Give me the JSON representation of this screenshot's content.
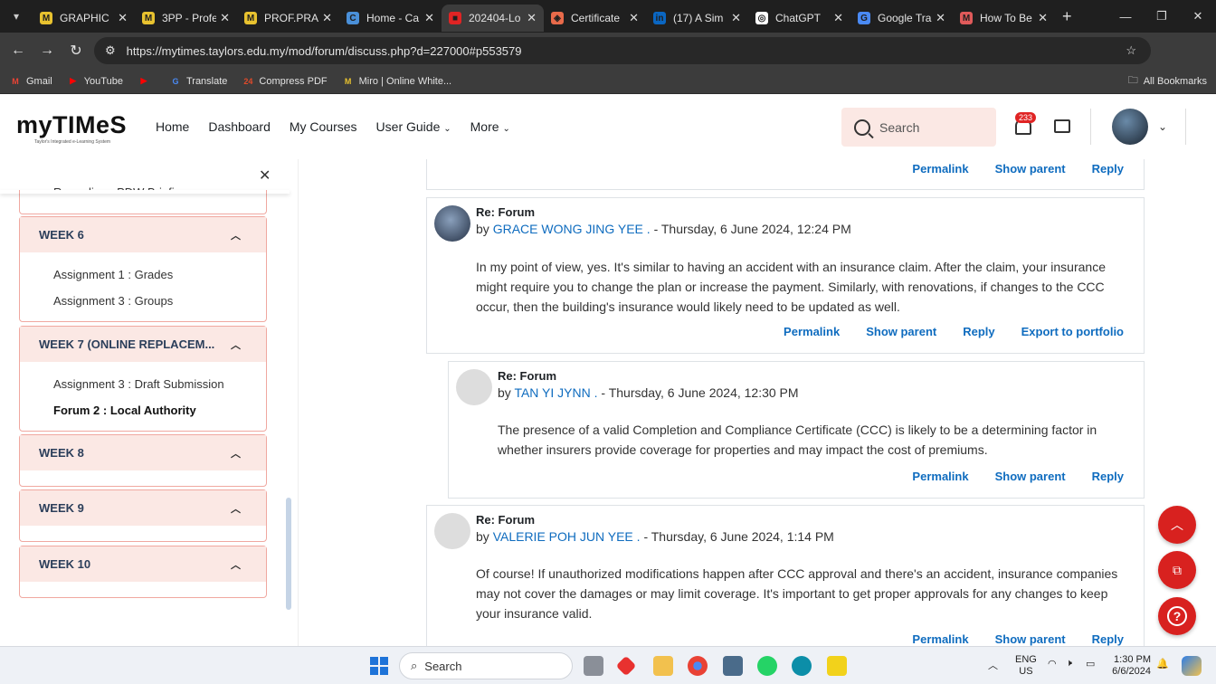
{
  "browser": {
    "tabs": [
      {
        "label": "GRAPHIC",
        "favicon": "M",
        "color": "#e8c22f"
      },
      {
        "label": "3PP - Profe",
        "favicon": "M",
        "color": "#e8c22f"
      },
      {
        "label": "PROF.PRAC",
        "favicon": "M",
        "color": "#e8c22f"
      },
      {
        "label": "Home - Ca",
        "favicon": "C",
        "color": "#4a90d9"
      },
      {
        "label": "202404-Lo",
        "favicon": "■",
        "color": "#e02424"
      },
      {
        "label": "Certificate",
        "favicon": "◈",
        "color": "#e86a4a"
      },
      {
        "label": "(17) A Sim",
        "favicon": "in",
        "color": "#0a66c2"
      },
      {
        "label": "ChatGPT",
        "favicon": "◎",
        "color": "#ffffff"
      },
      {
        "label": "Google Tra",
        "favicon": "G",
        "color": "#4a8af4"
      },
      {
        "label": "How To Be",
        "favicon": "M",
        "color": "#e05a5a"
      }
    ],
    "url": "https://mytimes.taylors.edu.my/mod/forum/discuss.php?d=227000#p553579",
    "profile_initial": "G",
    "bookmarks": [
      {
        "label": "Gmail",
        "icon": "M",
        "color": "#ea4335"
      },
      {
        "label": "YouTube",
        "icon": "▶",
        "color": "#ff0000"
      },
      {
        "label": "",
        "icon": "▶",
        "color": "#ff0000"
      },
      {
        "label": "Translate",
        "icon": "G",
        "color": "#4a8af4"
      },
      {
        "label": "Compress PDF",
        "icon": "24",
        "color": "#e04a2a"
      },
      {
        "label": "Miro | Online White...",
        "icon": "M",
        "color": "#e8c22f"
      }
    ],
    "all_bookmarks": "All Bookmarks"
  },
  "site": {
    "logo": "myTIMeS",
    "logo_sub": "Taylor's Integrated e-Learning System",
    "nav": [
      "Home",
      "Dashboard",
      "My Courses",
      "User Guide",
      "More"
    ],
    "search_placeholder": "Search",
    "notification_count": "233"
  },
  "sidebar": {
    "partial_item": "Recording : PDW Briefing",
    "weeks": [
      {
        "title": "WEEK 6",
        "items": [
          "Assignment 1 : Grades",
          "Assignment 3 : Groups"
        ]
      },
      {
        "title": "WEEK 7 (ONLINE REPLACEM...",
        "items": [
          "Assignment 3 : Draft Submission",
          "Forum 2 : Local Authority"
        ]
      },
      {
        "title": "WEEK 8",
        "items": []
      },
      {
        "title": "WEEK 9",
        "items": []
      },
      {
        "title": "WEEK 10",
        "items": []
      }
    ]
  },
  "posts": [
    {
      "subject": "Re: Forum",
      "by": "by",
      "author": "GRACE WONG JING YEE .",
      "date": "- Thursday, 6 June 2024, 12:24 PM",
      "body": "In my point of view, yes. It's similar to having an accident with an insurance claim. After the claim, your insurance might require you to change the plan or increase the payment. Similarly, with renovations, if changes to the CCC occur, then the building's insurance would likely need to be updated as well.",
      "actions": [
        "Permalink",
        "Show parent",
        "Reply",
        "Export to portfolio"
      ]
    },
    {
      "subject": "Re: Forum",
      "by": "by",
      "author": "TAN YI JYNN .",
      "date": "- Thursday, 6 June 2024, 12:30 PM",
      "body": "The presence of a valid Completion and Compliance Certificate (CCC) is likely to be a determining factor in whether insurers provide coverage for properties and may impact the cost of premiums.",
      "actions": [
        "Permalink",
        "Show parent",
        "Reply"
      ]
    },
    {
      "subject": "Re: Forum",
      "by": "by",
      "author": "VALERIE POH JUN YEE .",
      "date": "- Thursday, 6 June 2024, 1:14 PM",
      "body": "Of course! If unauthorized modifications happen after CCC approval and there's an accident, insurance companies may not cover the damages or may limit coverage. It's important to get proper approvals for any changes to keep your insurance valid.",
      "actions": [
        "Permalink",
        "Show parent",
        "Reply"
      ]
    }
  ],
  "top_actions": [
    "Permalink",
    "Show parent",
    "Reply"
  ],
  "taskbar": {
    "search": "Search",
    "lang": "ENG",
    "region": "US",
    "time": "1:30 PM",
    "date": "6/6/2024"
  }
}
